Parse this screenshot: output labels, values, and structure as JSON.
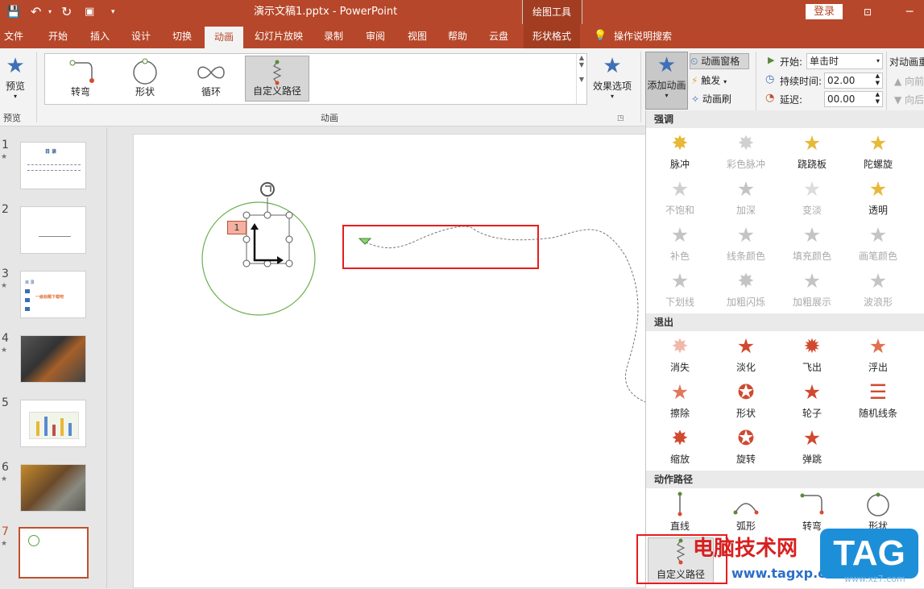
{
  "app": {
    "title": "演示文稿1.pptx - PowerPoint",
    "contextual_tool": "绘图工具",
    "login": "登录"
  },
  "tabs": [
    "文件",
    "开始",
    "插入",
    "设计",
    "切换",
    "动画",
    "幻灯片放映",
    "录制",
    "审阅",
    "视图",
    "帮助",
    "云盘",
    "形状格式"
  ],
  "active_tab": "动画",
  "tell_me": "操作说明搜索",
  "ribbon": {
    "preview_label": "预览",
    "preview_group": "预览",
    "animation_group": "动画",
    "gallery": [
      "转弯",
      "形状",
      "循环",
      "自定义路径"
    ],
    "effect_options": "效果选项",
    "add_animation": "添加动画",
    "anim_pane": "动画窗格",
    "trigger": "触发",
    "anim_painter": "动画刷",
    "start_label": "开始:",
    "start_value": "单击时",
    "duration_label": "持续时间:",
    "duration_value": "02.00",
    "delay_label": "延迟:",
    "delay_value": "00.00",
    "reorder": "对动画重",
    "move_earlier": "向前",
    "move_later": "向后"
  },
  "slides": [
    "1",
    "2",
    "3",
    "4",
    "5",
    "6",
    "7"
  ],
  "active_slide": "7",
  "thumb1_title": "目 录",
  "thumb3_title": "目 录",
  "thumb3_text": "一级标题下载吧",
  "anim_badge": "1",
  "dropdown": {
    "emphasis_header": "强调",
    "emphasis": [
      "脉冲",
      "彩色脉冲",
      "跷跷板",
      "陀螺旋",
      "不饱和",
      "加深",
      "变淡",
      "透明",
      "补色",
      "线条颜色",
      "填充颜色",
      "画笔颜色",
      "下划线",
      "加粗闪烁",
      "加粗展示",
      "波浪形"
    ],
    "exit_header": "退出",
    "exit": [
      "消失",
      "淡化",
      "飞出",
      "浮出",
      "擦除",
      "形状",
      "轮子",
      "随机线条",
      "缩放",
      "旋转",
      "弹跳"
    ],
    "path_header": "动作路径",
    "paths": [
      "直线",
      "弧形",
      "转弯",
      "形状"
    ],
    "custom_path": "自定义路径"
  },
  "watermark": {
    "site_cn": "电脑技术网",
    "site_url": "www.tagxp.com",
    "tag": "TAG",
    "site2": "www.xz7.com"
  }
}
